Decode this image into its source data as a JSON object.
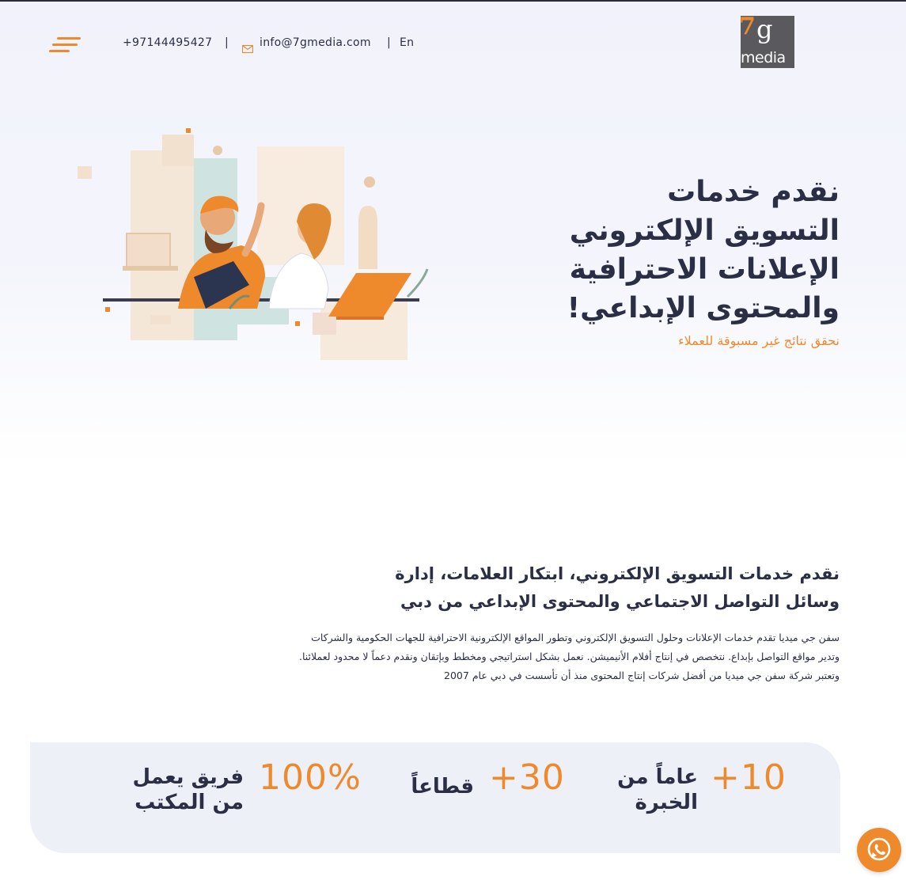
{
  "header": {
    "phone": "+97144495427",
    "email": "info@7gmedia.com",
    "language_switch": "En",
    "separator": "|",
    "logo": {
      "seven": "7",
      "g": "g",
      "word": "media"
    }
  },
  "hero": {
    "title_lines": [
      "نقدم خدمات",
      "التسويق الإلكتروني",
      "الإعلانات الاحترافية",
      "والمحتوى الإبداعي!"
    ],
    "subtitle": "نحقق نتائج غير مسبوقة للعملاء"
  },
  "intro": {
    "title_lines": [
      "نقدم خدمات التسويق الإلكتروني، ابتكار العلامات، إدارة",
      "وسائل التواصل الاجتماعي والمحتوى الإبداعي من دبي"
    ],
    "body_lines": [
      "سفن جي ميديا تقدم خدمات الإعلانات وحلول التسويق الإلكتروني وتطور المواقع الإلكترونية الاحترافية للجهات الحكومية والشركات",
      "وتدير مواقع التواصل بإبداع. نتخصص في إنتاج أفلام الأنيميشن. نعمل بشكل استراتيجي ومخطط وبإتقان ونقدم دعماً لا محدود لعملائنا.",
      "وتعتبر شركة سفن جي ميديا من أفضل شركات إنتاج المحتوى منذ أن تأسست في دبي عام 2007"
    ]
  },
  "stats": [
    {
      "number": "+10",
      "label_lines": [
        "عاماً من",
        "الخبرة"
      ]
    },
    {
      "number": "+30",
      "label_lines": [
        "قطاعاً"
      ]
    },
    {
      "number": "100%",
      "label_lines": [
        "فريق يعمل",
        "من المكتب"
      ]
    }
  ],
  "colors": {
    "accent": "#ee8a2c",
    "text": "#2b2f45",
    "stats_bg": "#eef0f8"
  },
  "icons": {
    "menu": "hamburger-menu-icon",
    "email": "envelope-icon",
    "whatsapp": "whatsapp-icon"
  }
}
